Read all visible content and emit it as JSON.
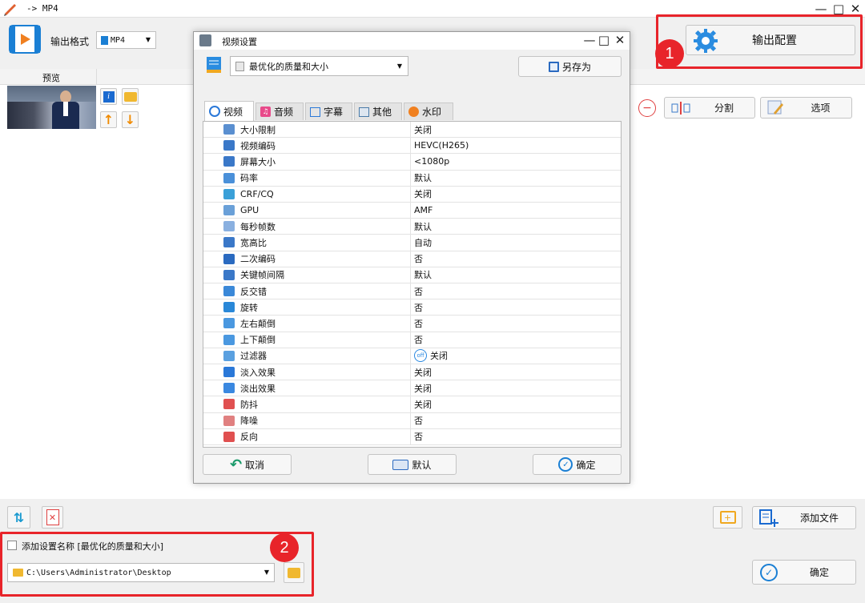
{
  "window": {
    "title": "-> MP4",
    "controls": [
      "minimize-icon",
      "maximize-icon",
      "close-icon"
    ]
  },
  "toolbar": {
    "format_label": "输出格式",
    "format_value": "MP4",
    "output_config_label": "输出配置"
  },
  "file_list": {
    "preview_header": "预览"
  },
  "right_actions": {
    "split_label": "分割",
    "options_label": "选项"
  },
  "bottom": {
    "add_file_label": "添加文件",
    "checkbox_label": "添加设置名称 [最优化的质量和大小]",
    "path_value": "C:\\Users\\Administrator\\Desktop",
    "confirm_label": "确定"
  },
  "annotations": {
    "badge1": "1",
    "badge2": "2"
  },
  "dialog": {
    "title": "视频设置",
    "preset_value": "最优化的质量和大小",
    "save_as_label": "另存为",
    "tabs": [
      {
        "label": "视频",
        "icon": "video-tab-icon"
      },
      {
        "label": "音频",
        "icon": "music-tab-icon"
      },
      {
        "label": "字幕",
        "icon": "subtitle-tab-icon"
      },
      {
        "label": "其他",
        "icon": "other-tab-icon"
      },
      {
        "label": "水印",
        "icon": "watermark-tab-icon"
      }
    ],
    "rows": [
      {
        "name": "大小限制",
        "value": "关闭",
        "color": "#5a8fd0"
      },
      {
        "name": "视频编码",
        "value": "HEVC(H265)",
        "color": "#3a78c8"
      },
      {
        "name": "屏幕大小",
        "value": "<1080p",
        "color": "#3a78c8"
      },
      {
        "name": "码率",
        "value": "默认",
        "color": "#4a90d9"
      },
      {
        "name": "CRF/CQ",
        "value": "关闭",
        "color": "#3aa0d8"
      },
      {
        "name": "GPU",
        "value": "AMF",
        "color": "#6aa0d8"
      },
      {
        "name": "每秒帧数",
        "value": "默认",
        "color": "#8ab0e0"
      },
      {
        "name": "宽高比",
        "value": "自动",
        "color": "#3a78c8"
      },
      {
        "name": "二次编码",
        "value": "否",
        "color": "#2a6ac0"
      },
      {
        "name": "关键帧间隔",
        "value": "默认",
        "color": "#3a78c8"
      },
      {
        "name": "反交错",
        "value": "否",
        "color": "#3a88d8"
      },
      {
        "name": "旋转",
        "value": "否",
        "color": "#2a88d8"
      },
      {
        "name": "左右颠倒",
        "value": "否",
        "color": "#4a98e0"
      },
      {
        "name": "上下颠倒",
        "value": "否",
        "color": "#4a98e0"
      },
      {
        "name": "过滤器",
        "value": "关闭",
        "color": "#5aa0e0",
        "toggle": "off"
      },
      {
        "name": "淡入效果",
        "value": "关闭",
        "color": "#2a78d8"
      },
      {
        "name": "淡出效果",
        "value": "关闭",
        "color": "#3a88e0"
      },
      {
        "name": "防抖",
        "value": "关闭",
        "color": "#e05050"
      },
      {
        "name": "降噪",
        "value": "否",
        "color": "#e08080"
      },
      {
        "name": "反向",
        "value": "否",
        "color": "#e05050"
      }
    ],
    "cancel_label": "取消",
    "default_label": "默认",
    "ok_label": "确定"
  },
  "colors": {
    "accent": "#1a7fd4",
    "annotation_red": "#e8242a"
  }
}
